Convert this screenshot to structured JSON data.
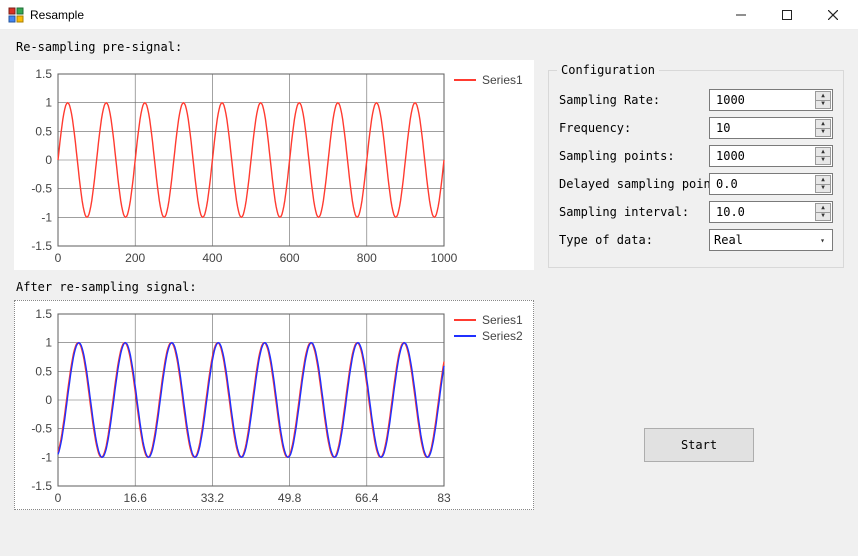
{
  "window": {
    "title": "Resample"
  },
  "labels": {
    "section_pre": "Re-sampling pre-signal:",
    "section_post": "After re-sampling signal:"
  },
  "config": {
    "groupbox_title": "Configuration",
    "rows": {
      "sampling_rate": {
        "label": "Sampling Rate:",
        "value": "1000"
      },
      "frequency": {
        "label": "Frequency:",
        "value": "10"
      },
      "sampling_points": {
        "label": "Sampling points:",
        "value": "1000"
      },
      "delayed_point": {
        "label": "Delayed sampling point",
        "value": "0.0"
      },
      "sampling_interval": {
        "label": "Sampling interval:",
        "value": "10.0"
      },
      "type_of_data": {
        "label": "Type of data:",
        "value": "Real"
      }
    }
  },
  "buttons": {
    "start": "Start"
  },
  "chart_data": [
    {
      "type": "line",
      "title": "",
      "xlabel": "",
      "ylabel": "",
      "xlim": [
        0,
        1000
      ],
      "ylim": [
        -1.5,
        1.5
      ],
      "xticks": [
        0,
        200,
        400,
        600,
        800,
        1000
      ],
      "yticks": [
        -1.5,
        -1,
        -0.5,
        0,
        0.5,
        1,
        1.5
      ],
      "legend": {
        "items": [
          "Series1"
        ],
        "colors": [
          "#ff3b30"
        ]
      },
      "series": [
        {
          "name": "Series1",
          "color": "#ff3b30",
          "generator": "sin",
          "amplitude": 1.0,
          "cycles": 10,
          "phase": 0,
          "points": 400
        }
      ]
    },
    {
      "type": "line",
      "title": "",
      "xlabel": "",
      "ylabel": "",
      "xlim": [
        0,
        83
      ],
      "ylim": [
        -1.5,
        1.5
      ],
      "xticks": [
        0,
        16.6,
        33.2,
        49.8,
        66.4,
        83
      ],
      "yticks": [
        -1.5,
        -1,
        -0.5,
        0,
        0.5,
        1,
        1.5
      ],
      "legend": {
        "items": [
          "Series1",
          "Series2"
        ],
        "colors": [
          "#ff3b30",
          "#2030ff"
        ]
      },
      "series": [
        {
          "name": "Series1",
          "color": "#ff3b30",
          "generator": "sin",
          "amplitude": 1.0,
          "cycles": 8.3,
          "phase": -1.15,
          "points": 400
        },
        {
          "name": "Series2",
          "color": "#2030ff",
          "generator": "sin",
          "amplitude": 1.0,
          "cycles": 8.3,
          "phase": -1.25,
          "points": 400
        }
      ]
    }
  ]
}
